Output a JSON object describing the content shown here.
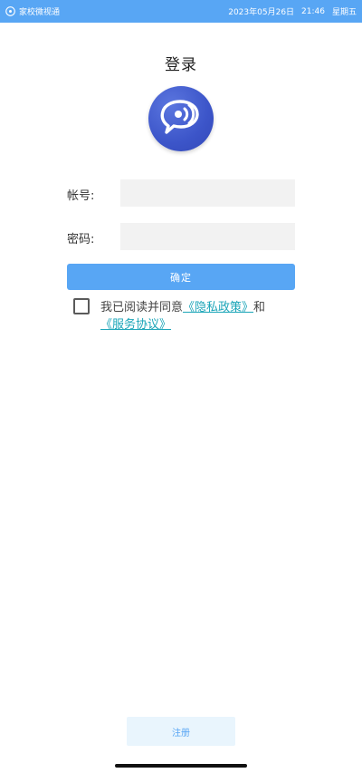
{
  "status_bar": {
    "app_name": "家校微视通",
    "date": "2023年05月26日",
    "time": "21:46",
    "weekday": "星期五",
    "background_color": "#58a6f4"
  },
  "header": {
    "title": "登录"
  },
  "logo": {
    "icon": "chat-bubble-signal-icon",
    "color": "#3c55c9"
  },
  "form": {
    "account_label": "帐号:",
    "account_value": "",
    "account_placeholder": "",
    "password_label": "密码:",
    "password_value": "",
    "password_placeholder": ""
  },
  "confirm_button": {
    "label": "确定",
    "color": "#58a6f4"
  },
  "agreement": {
    "checked": false,
    "prefix": "我已阅读并同意",
    "privacy_link": "《隐私政策》",
    "joiner": "和",
    "terms_link": "《服务协议》",
    "link_color": "#1ba5b8"
  },
  "register_button": {
    "label": "注册"
  }
}
